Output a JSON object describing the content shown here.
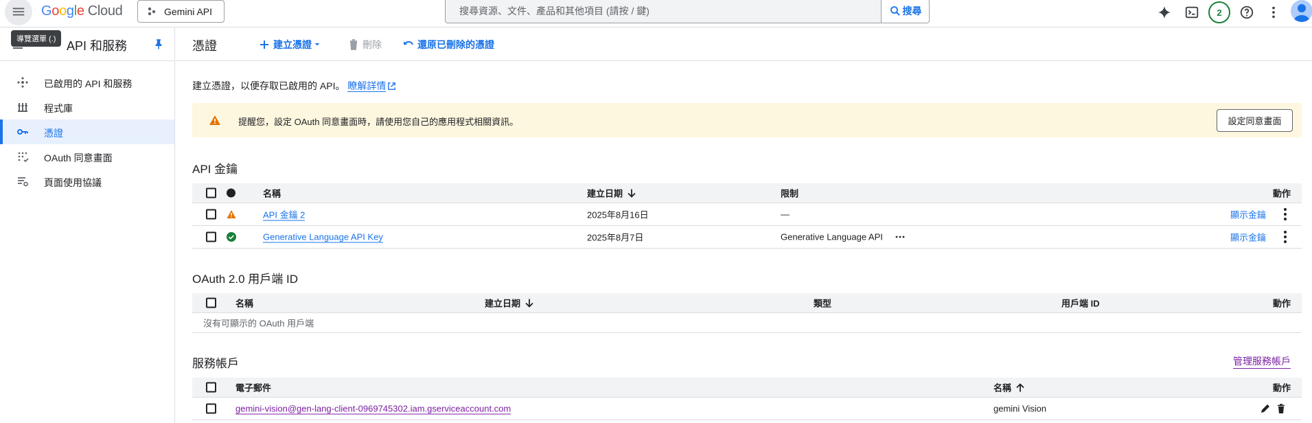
{
  "topbar": {
    "logo": {
      "G": "G",
      "o1": "o",
      "o2": "o",
      "g": "g",
      "l": "l",
      "e": "e",
      "cloud": "Cloud"
    },
    "project": "Gemini API",
    "search_placeholder": "搜尋資源、文件、產品和其他項目 (請按 / 鍵)",
    "search_button": "搜尋",
    "notification_count": "2",
    "tooltip": "導覽選單 (.)"
  },
  "sidebar": {
    "title": "API 和服務",
    "items": [
      {
        "label": "已啟用的 API 和服務",
        "icon": "api-icon"
      },
      {
        "label": "程式庫",
        "icon": "library-icon"
      },
      {
        "label": "憑證",
        "icon": "key-icon",
        "active": true
      },
      {
        "label": "OAuth 同意畫面",
        "icon": "oauth-icon"
      },
      {
        "label": "頁面使用協議",
        "icon": "settings-list-icon"
      }
    ]
  },
  "page": {
    "title": "憑證",
    "actions": {
      "create": "建立憑證",
      "delete": "刪除",
      "restore": "還原已刪除的憑證"
    },
    "intro_text": "建立憑證，以便存取已啟用的 API。",
    "intro_link": "瞭解詳情"
  },
  "banner": {
    "text": "提醒您，設定 OAuth 同意畫面時，請使用您自己的應用程式相關資訊。",
    "button": "設定同意畫面"
  },
  "api_keys": {
    "title": "API 金鑰",
    "headers": {
      "name": "名稱",
      "created": "建立日期",
      "restrictions": "限制",
      "actions": "動作"
    },
    "rows": [
      {
        "name": "API 金鑰 2",
        "created": "2025年8月16日",
        "restrictions": "—",
        "action": "顯示金鑰",
        "status": "warning"
      },
      {
        "name": "Generative Language API Key",
        "created": "2025年8月7日",
        "restrictions": "Generative Language API",
        "action": "顯示金鑰",
        "status": "ok"
      }
    ]
  },
  "oauth": {
    "title": "OAuth 2.0 用戶端 ID",
    "headers": {
      "name": "名稱",
      "created": "建立日期",
      "type": "類型",
      "client_id": "用戶端 ID",
      "actions": "動作"
    },
    "empty": "沒有可顯示的 OAuth 用戶端"
  },
  "service_accounts": {
    "title": "服務帳戶",
    "manage_link": "管理服務帳戶",
    "headers": {
      "email": "電子郵件",
      "name": "名稱",
      "actions": "動作"
    },
    "rows": [
      {
        "email": "gemini-vision@gen-lang-client-0969745302.iam.gserviceaccount.com",
        "name": "gemini Vision"
      }
    ]
  },
  "colors": {
    "accent": "#1a73e8",
    "warning": "#e37400",
    "success": "#188038",
    "visited": "#7b1fa2",
    "banner_bg": "#fef7e0"
  }
}
